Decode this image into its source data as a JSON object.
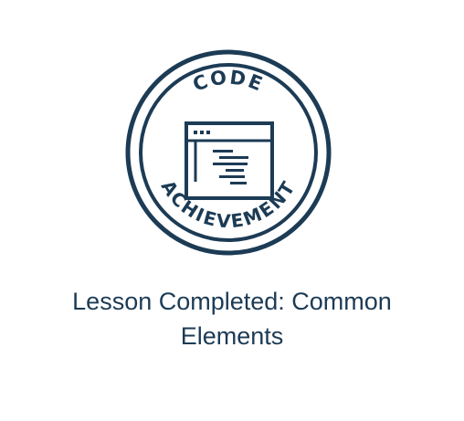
{
  "badge": {
    "top_text": "CODE",
    "bottom_text": "ACHIEVEMENT",
    "color": "#1c3b55",
    "icon": "code-window-icon"
  },
  "lesson": {
    "title_line1": "Lesson Completed: Common",
    "title_line2": "Elements"
  }
}
